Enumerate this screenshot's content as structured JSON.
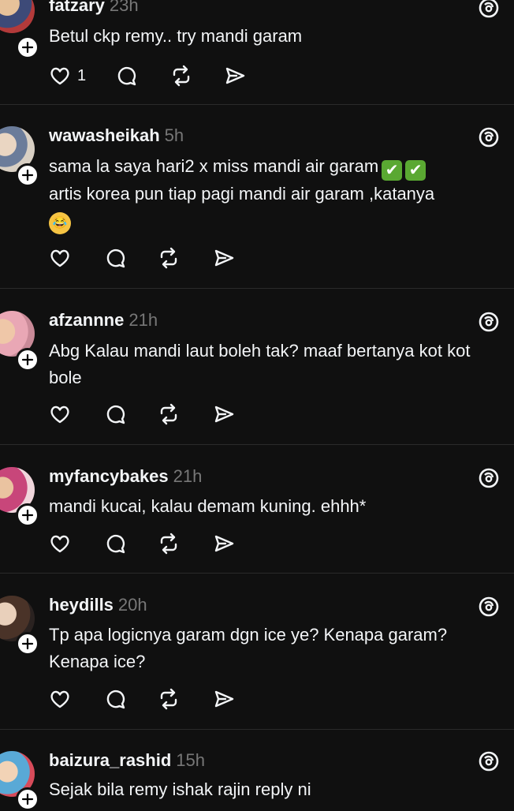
{
  "posts": [
    {
      "username": "fatzary",
      "time": "23h",
      "text": "Betul ckp remy.. try mandi garam",
      "likes": "1"
    },
    {
      "username": "wawasheikah",
      "time": "5h",
      "text_line1": "sama la  saya hari2 x miss mandi air garam",
      "emoji_check": "✔",
      "text_line2": "artis korea pun tiap pagi mandi air garam ,katanya",
      "emoji_laugh": "😂",
      "likes": ""
    },
    {
      "username": "afzannne",
      "time": "21h",
      "text": "Abg Kalau mandi laut boleh tak? maaf bertanya kot kot bole",
      "likes": ""
    },
    {
      "username": "myfancybakes",
      "time": "21h",
      "text": "mandi kucai, kalau demam kuning. ehhh*",
      "likes": ""
    },
    {
      "username": "heydills",
      "time": "20h",
      "text": "Tp apa logicnya garam dgn ice ye? Kenapa garam? Kenapa ice?",
      "likes": ""
    },
    {
      "username": "baizura_rashid",
      "time": "15h",
      "text": "Sejak bila remy ishak rajin reply ni",
      "likes": ""
    }
  ],
  "icons": {
    "like": "heart-icon",
    "reply": "comment-icon",
    "repost": "repost-icon",
    "share": "send-icon",
    "brand": "threads-icon",
    "follow": "plus-icon"
  },
  "colors": {
    "background": "#101010",
    "text": "#f3f5f7",
    "muted": "#777777",
    "divider": "#2a2a2a"
  }
}
